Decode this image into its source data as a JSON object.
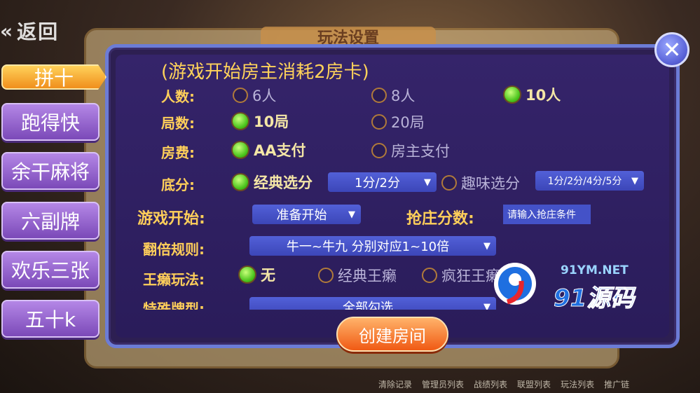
{
  "background": {
    "back_label": "返回",
    "panel_title": "玩法设置",
    "bottom_items": [
      "清除记录",
      "管理员列表",
      "战绩列表",
      "联盟列表",
      "玩法列表",
      "推广链"
    ]
  },
  "modes": [
    {
      "label": "拼十",
      "active": true
    },
    {
      "label": "跑得快",
      "active": false
    },
    {
      "label": "余干麻将",
      "active": false
    },
    {
      "label": "六副牌",
      "active": false
    },
    {
      "label": "欢乐三张",
      "active": false
    },
    {
      "label": "五十k",
      "active": false
    }
  ],
  "notice": "(游戏开始房主消耗2房卡)",
  "settings": {
    "players": {
      "label": "人数:",
      "options": [
        "6人",
        "8人",
        "10人"
      ],
      "selected": "10人"
    },
    "rounds": {
      "label": "局数:",
      "options": [
        "10局",
        "20局"
      ],
      "selected": "10局"
    },
    "fee": {
      "label": "房费:",
      "options": [
        "AA支付",
        "房主支付"
      ],
      "selected": "AA支付"
    },
    "base_score": {
      "label": "底分:",
      "classic": {
        "label": "经典选分",
        "value": "1分/2分"
      },
      "fun": {
        "label": "趣味选分",
        "value": "1分/2分/4分/5分"
      },
      "selected": "经典选分"
    },
    "game_start": {
      "label": "游戏开始:",
      "value": "准备开始"
    },
    "banker_score": {
      "label": "抢庄分数:",
      "placeholder": "请输入抢庄条件"
    },
    "double_rule": {
      "label": "翻倍规则:",
      "value": "牛一~牛九 分别对应1~10倍"
    },
    "wild_card": {
      "label": "王癞玩法:",
      "options": [
        "无",
        "经典王癞",
        "疯狂王癞"
      ],
      "selected": "无"
    },
    "special_cards": {
      "label": "特殊牌型:",
      "value": "全部勾选"
    }
  },
  "create_button": "创建房间",
  "close_icon": "close-icon",
  "watermark": {
    "url": "91YM.NET",
    "text": "91源码"
  },
  "colors": {
    "accent": "#ffcf5a",
    "modal_border": "#6c7cd6",
    "selected_radio": "#47c21a",
    "button": "#f05a14"
  }
}
